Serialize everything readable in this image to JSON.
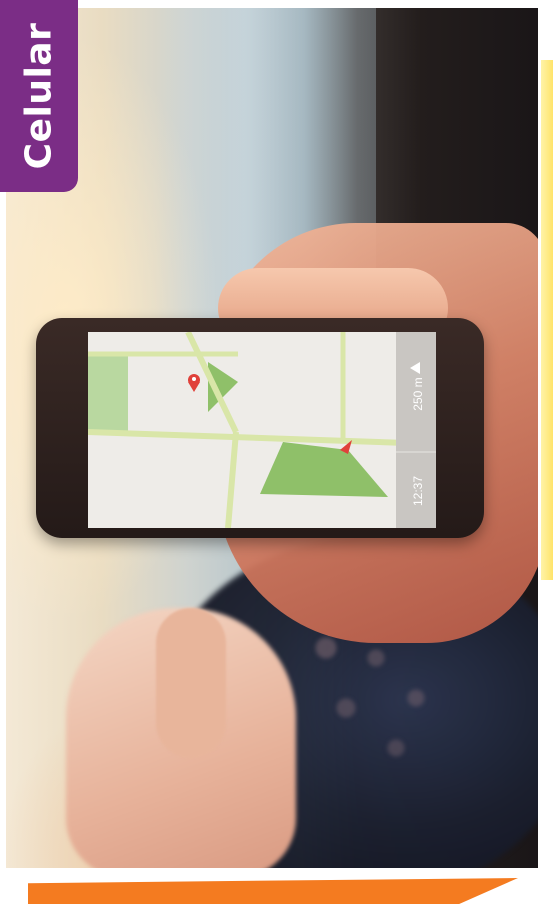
{
  "category": {
    "label": "Celular",
    "background_color": "#7b2d86",
    "text_color": "#ffffff"
  },
  "phone_screen": {
    "time_label": "12:37",
    "distance_label": "250 m",
    "direction_icon": "navigation-arrow-icon",
    "pin_icons": [
      "destination-pin-icon",
      "current-location-icon"
    ]
  },
  "accents": {
    "bottom_stripe_color": "#f47b20",
    "side_accent_color": "#ffe46a"
  }
}
